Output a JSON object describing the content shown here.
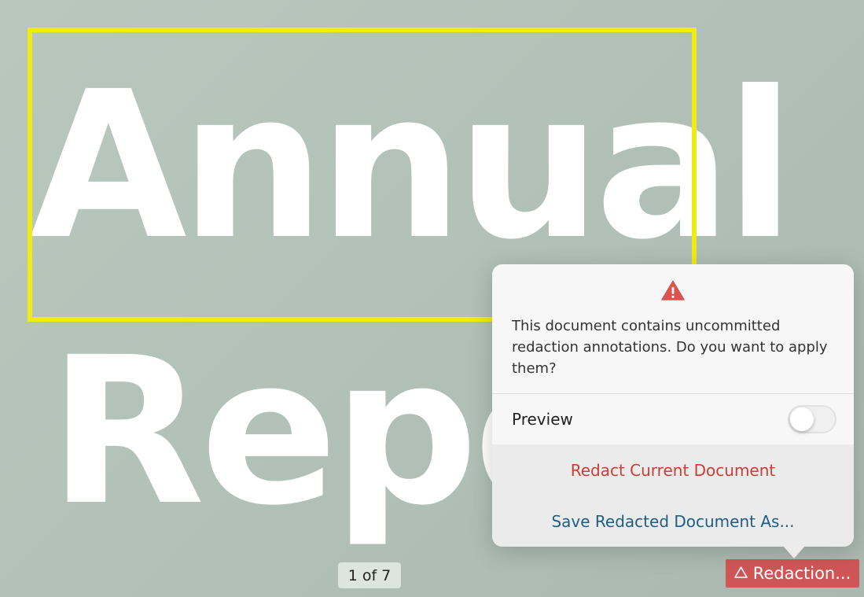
{
  "document": {
    "line1": "Annual",
    "line2": "Repo"
  },
  "colors": {
    "redaction_box": "#f0ec12",
    "redaction_button": "#cf5656",
    "destructive_action": "#cb3e33",
    "link_action": "#1f5e82"
  },
  "page_indicator": {
    "label": "1 of 7"
  },
  "redaction_button": {
    "icon": "warning-triangle-outline-icon",
    "label": "Redaction..."
  },
  "popover": {
    "icon": "warning-triangle-icon",
    "message": "This document contains uncommitted redaction annotations. Do you want to apply them?",
    "preview": {
      "label": "Preview",
      "enabled": false
    },
    "actions": {
      "redact_current": "Redact Current Document",
      "save_redacted_as": "Save Redacted Document As..."
    }
  }
}
